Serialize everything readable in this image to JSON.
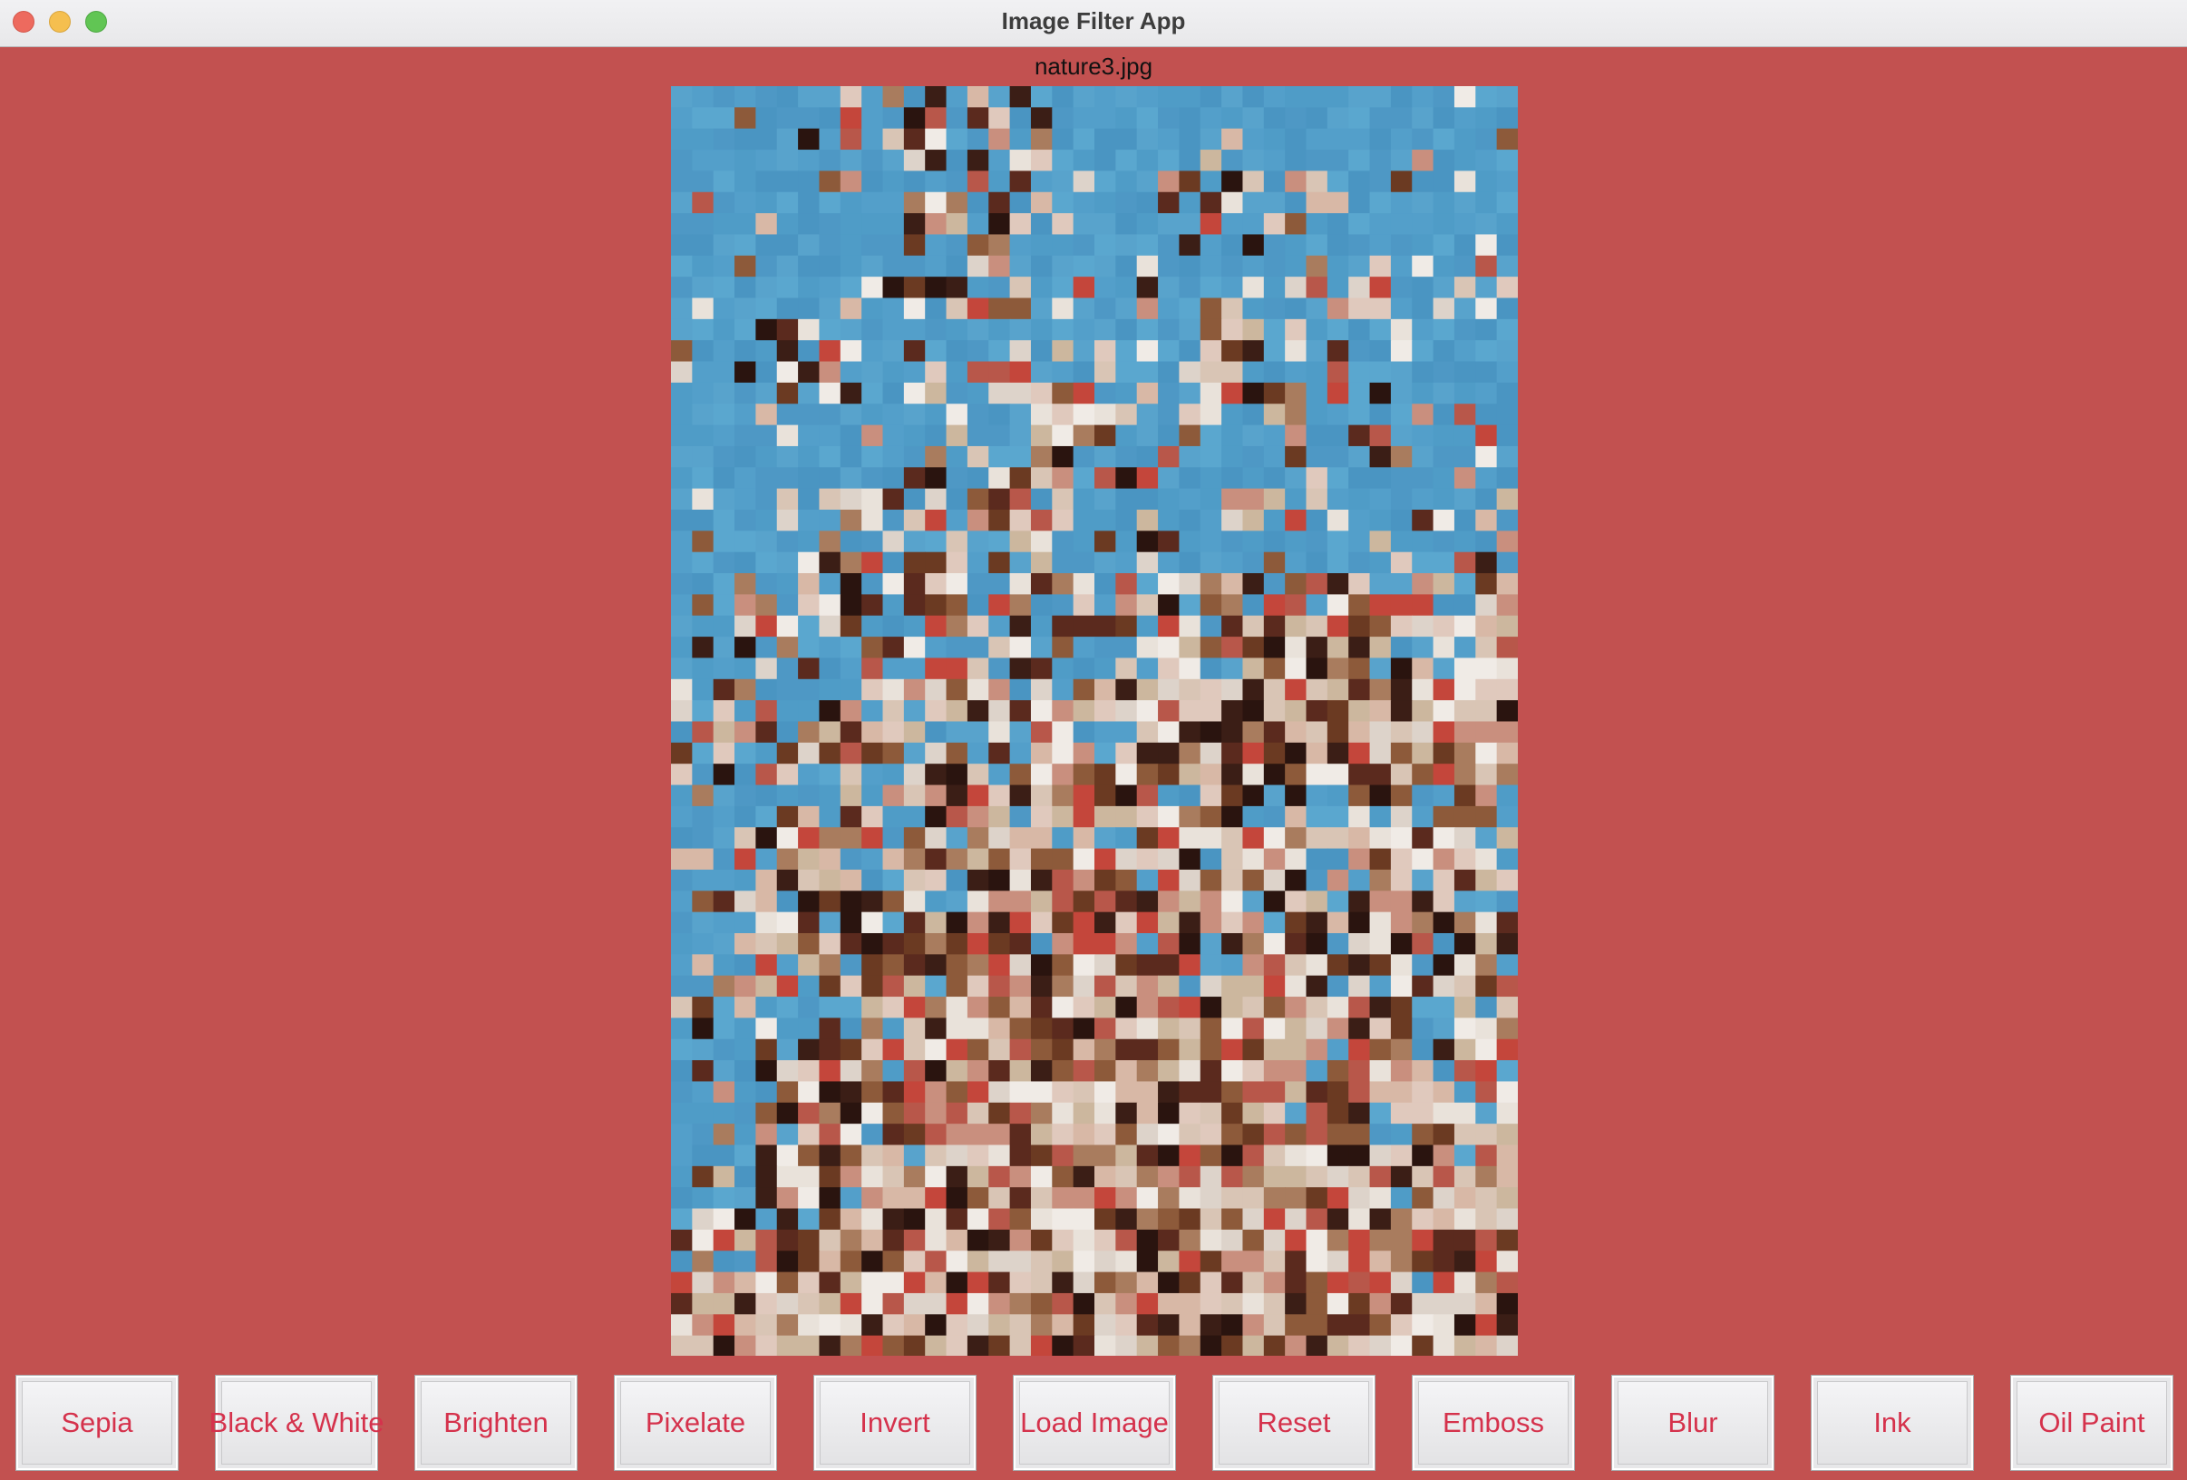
{
  "window": {
    "title": "Image Filter App",
    "background": "#c25150"
  },
  "image": {
    "filename": "nature3.jpg",
    "description_icon": "pixelated-photo"
  },
  "buttons": [
    {
      "name": "sepia-button",
      "label": "Sepia"
    },
    {
      "name": "black-white-button",
      "label": "Black & White"
    },
    {
      "name": "brighten-button",
      "label": "Brighten"
    },
    {
      "name": "pixelate-button",
      "label": "Pixelate"
    },
    {
      "name": "invert-button",
      "label": "Invert"
    },
    {
      "name": "load-image-button",
      "label": "Load Image"
    },
    {
      "name": "reset-button",
      "label": "Reset"
    },
    {
      "name": "emboss-button",
      "label": "Emboss"
    },
    {
      "name": "blur-button",
      "label": "Blur"
    },
    {
      "name": "ink-button",
      "label": "Ink"
    },
    {
      "name": "oil-paint-button",
      "label": "Oil Paint"
    }
  ],
  "colors": {
    "button_text": "#d5324c",
    "sky": "#4f9cc7"
  }
}
